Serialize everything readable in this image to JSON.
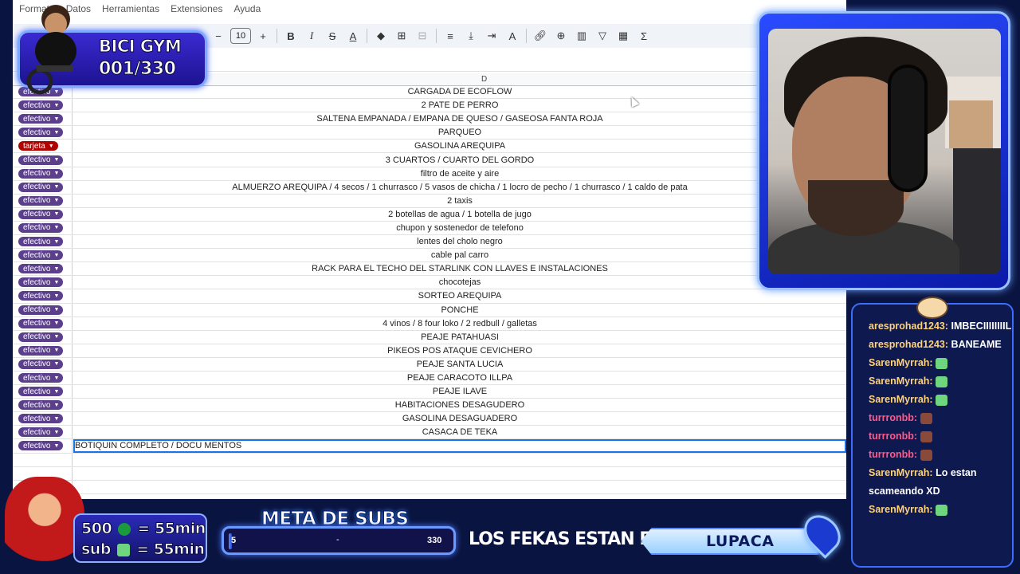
{
  "menubar": {
    "items": [
      "Formato",
      "Datos",
      "Herramientas",
      "Extensiones",
      "Ayuda"
    ]
  },
  "toolbar": {
    "font_size": "10"
  },
  "sheet": {
    "column_label": "D",
    "rows": [
      {
        "payment": "efectivo",
        "description": "CARGADA DE ECOFLOW"
      },
      {
        "payment": "efectivo",
        "description": "2 PATE DE PERRO"
      },
      {
        "payment": "efectivo",
        "description": "SALTENA EMPANADA / EMPANA DE QUESO / GASEOSA FANTA ROJA"
      },
      {
        "payment": "efectivo",
        "description": "PARQUEO"
      },
      {
        "payment": "tarjeta",
        "description": "GASOLINA AREQUIPA"
      },
      {
        "payment": "efectivo",
        "description": "3 CUARTOS / CUARTO DEL GORDO"
      },
      {
        "payment": "efectivo",
        "description": "filtro de aceite y aire"
      },
      {
        "payment": "efectivo",
        "description": "ALMUERZO AREQUIPA / 4 secos / 1 churrasco / 5 vasos de chicha / 1 locro de pecho / 1 churrasco / 1 caldo de pata"
      },
      {
        "payment": "efectivo",
        "description": "2 taxis"
      },
      {
        "payment": "efectivo",
        "description": "2 botellas de agua / 1 botella de jugo"
      },
      {
        "payment": "efectivo",
        "description": "chupon y sostenedor de telefono"
      },
      {
        "payment": "efectivo",
        "description": "lentes del cholo negro"
      },
      {
        "payment": "efectivo",
        "description": "cable pal carro"
      },
      {
        "payment": "efectivo",
        "description": "RACK PARA EL TECHO DEL STARLINK CON LLAVES E INSTALACIONES"
      },
      {
        "payment": "efectivo",
        "description": "chocotejas"
      },
      {
        "payment": "efectivo",
        "description": "SORTEO AREQUIPA"
      },
      {
        "payment": "efectivo",
        "description": "PONCHE"
      },
      {
        "payment": "efectivo",
        "description": "4 vinos / 8 four loko / 2 redbull / galletas"
      },
      {
        "payment": "efectivo",
        "description": "PEAJE PATAHUASI"
      },
      {
        "payment": "efectivo",
        "description": "PIKEOS POS ATAQUE CEVICHERO"
      },
      {
        "payment": "efectivo",
        "description": "PEAJE SANTA LUCIA"
      },
      {
        "payment": "efectivo",
        "description": "PEAJE CARACOTO ILLPA"
      },
      {
        "payment": "efectivo",
        "description": "PEAJE ILAVE"
      },
      {
        "payment": "efectivo",
        "description": "HABITACIONES DESAGUDERO"
      },
      {
        "payment": "efectivo",
        "description": "GASOLINA DESAGUADERO"
      },
      {
        "payment": "efectivo",
        "description": "CASACA DE TEKA"
      },
      {
        "payment": "efectivo",
        "description": "BOTIQUIN COMPLETO  / DOCU MENTOS"
      }
    ]
  },
  "overlay": {
    "bici_title": "BICI GYM",
    "bici_count": "001/330",
    "rate_bits": "500",
    "rate_sub": "sub",
    "rate_time": "= 55min",
    "meta_title": "META DE SUBS",
    "meta_current": "5",
    "meta_separator": "-",
    "meta_goal": "330",
    "meta_progress_fraction": 0.015,
    "location_prefix": "LOS FEKAS ESTAN EN:",
    "location_name": "LUPACA"
  },
  "chat": {
    "messages": [
      {
        "user": "aresprohad1243:",
        "text": "IMBECIIIIIIIIL",
        "color": "gold"
      },
      {
        "user": "aresprohad1243:",
        "text": "BANEAME",
        "color": "gold"
      },
      {
        "user": "SarenMyrrah:",
        "text": "",
        "emote": "green",
        "color": "gold"
      },
      {
        "user": "SarenMyrrah:",
        "text": "",
        "emote": "green",
        "color": "gold"
      },
      {
        "user": "SarenMyrrah:",
        "text": "",
        "emote": "green",
        "color": "gold"
      },
      {
        "user": "turrronbb:",
        "text": "",
        "emote": "brown",
        "color": "pink"
      },
      {
        "user": "turrronbb:",
        "text": "",
        "emote": "brown",
        "color": "pink"
      },
      {
        "user": "turrronbb:",
        "text": "",
        "emote": "brown",
        "color": "pink"
      },
      {
        "user": "SarenMyrrah:",
        "text": "Lo estan scameando XD",
        "color": "gold"
      },
      {
        "user": "SarenMyrrah:",
        "text": "",
        "emote": "green",
        "color": "gold"
      }
    ]
  },
  "colors": {
    "efectivo_chip": "#5b3f8c",
    "tarjeta_chip": "#b10202",
    "selection": "#1a73e8",
    "overlay_blue": "#2a4cff"
  }
}
